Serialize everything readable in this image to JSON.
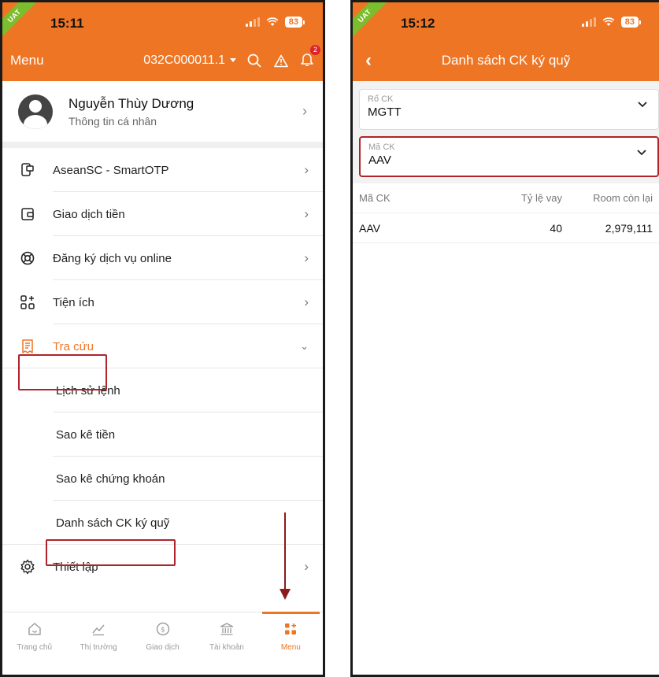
{
  "left": {
    "status": {
      "uat": "UAT",
      "time": "15:11",
      "battery": "83"
    },
    "header": {
      "title": "Menu",
      "account": "032C000011.1",
      "bell_badge": "2"
    },
    "profile": {
      "name": "Nguyễn Thùy Dương",
      "subtitle": "Thông tin cá nhân"
    },
    "menu": [
      {
        "label": "AseanSC - SmartOTP",
        "icon": "smartotp-icon"
      },
      {
        "label": "Giao dịch tiền",
        "icon": "wallet-icon"
      },
      {
        "label": "Đăng ký dịch vụ online",
        "icon": "lifebuoy-icon"
      },
      {
        "label": "Tiện ích",
        "icon": "apps-add-icon"
      },
      {
        "label": "Tra cứu",
        "icon": "receipt-icon"
      }
    ],
    "submenu": [
      "Lịch sử lệnh",
      "Sao kê tiền",
      "Sao kê chứng khoán",
      "Danh sách CK ký quỹ"
    ],
    "settings": {
      "label": "Thiết lập",
      "icon": "gear-icon"
    },
    "tabs": [
      {
        "label": "Trang chủ",
        "icon": "home-icon"
      },
      {
        "label": "Thị trường",
        "icon": "chart-icon"
      },
      {
        "label": "Giao dịch",
        "icon": "dollar-icon"
      },
      {
        "label": "Tài khoản",
        "icon": "bank-icon"
      },
      {
        "label": "Menu",
        "icon": "menu-grid-icon"
      }
    ]
  },
  "right": {
    "status": {
      "uat": "UAT",
      "time": "15:12",
      "battery": "83"
    },
    "header": {
      "title": "Danh sách CK ký quỹ"
    },
    "filters": [
      {
        "label": "Rổ CK",
        "value": "MGTT"
      },
      {
        "label": "Mã CK",
        "value": "AAV"
      }
    ],
    "table": {
      "columns": [
        "Mã CK",
        "Tỷ lệ vay",
        "Room còn lại"
      ],
      "rows": [
        [
          "AAV",
          "40",
          "2,979,111"
        ]
      ]
    }
  },
  "colors": {
    "brand": "#ee7524",
    "highlight": "#b0232a",
    "uat": "#7cbd2e"
  }
}
